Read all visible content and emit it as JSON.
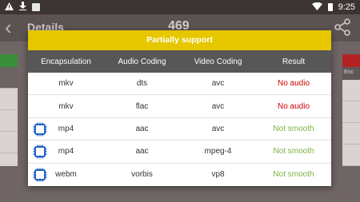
{
  "status_bar": {
    "time": "9:25",
    "icons": [
      "alert-icon",
      "download-icon",
      "notification-box-icon",
      "wifi-icon",
      "battery-icon"
    ]
  },
  "background_app": {
    "title": "Details",
    "count": "469",
    "right_header_fragment": "Enc"
  },
  "dialog": {
    "title": "Partially support",
    "title_bar_color": "#e6c700",
    "header_color": "#575757",
    "columns": [
      "Encapsulation",
      "Audio Coding",
      "Video Coding",
      "Result"
    ],
    "rows": [
      {
        "encapsulation": "mkv",
        "audio": "dts",
        "video": "avc",
        "result": "No audio",
        "result_color": "#d40000",
        "chip_icon": false
      },
      {
        "encapsulation": "mkv",
        "audio": "flac",
        "video": "avc",
        "result": "No audio",
        "result_color": "#d40000",
        "chip_icon": false
      },
      {
        "encapsulation": "mp4",
        "audio": "aac",
        "video": "avc",
        "result": "Not smooth",
        "result_color": "#7cb342",
        "chip_icon": true
      },
      {
        "encapsulation": "mp4",
        "audio": "aac",
        "video": "mpeg-4",
        "result": "Not smooth",
        "result_color": "#7cb342",
        "chip_icon": true
      },
      {
        "encapsulation": "webm",
        "audio": "vorbis",
        "video": "vp8",
        "result": "Not smooth",
        "result_color": "#7cb342",
        "chip_icon": true
      }
    ]
  }
}
